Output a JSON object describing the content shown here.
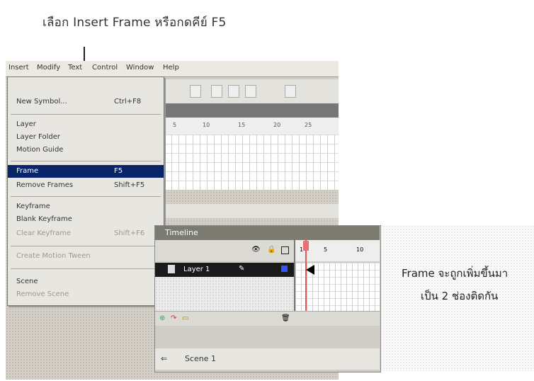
{
  "caption_top": "เลือก Insert   Frame หรือกดคีย์ F5",
  "caption_right": {
    "line1": "Frame จะถูกเพิ่มขึ้นมา",
    "line2": "เป็น 2 ช่องติดกัน"
  },
  "menubar": [
    "Insert",
    "Modify",
    "Text",
    "Control",
    "Window",
    "Help"
  ],
  "menu": {
    "new_symbol": {
      "label": "New Symbol...",
      "shortcut": "Ctrl+F8"
    },
    "layer": "Layer",
    "layer_folder": "Layer Folder",
    "motion_guide": "Motion Guide",
    "frame": {
      "label": "Frame",
      "shortcut": "F5"
    },
    "remove_frames": {
      "label": "Remove Frames",
      "shortcut": "Shift+F5"
    },
    "keyframe": "Keyframe",
    "blank_keyframe": "Blank Keyframe",
    "clear_keyframe": {
      "label": "Clear Keyframe",
      "shortcut": "Shift+F6"
    },
    "create_motion_tween": "Create Motion Tween",
    "scene": "Scene",
    "remove_scene": "Remove Scene"
  },
  "ruler_marks": [
    "5",
    "10",
    "15",
    "20",
    "25"
  ],
  "timeline": {
    "title": "Timeline",
    "layer_name": "Layer 1",
    "frame_numbers": [
      "1",
      "5",
      "10"
    ],
    "scene": "Scene 1"
  }
}
